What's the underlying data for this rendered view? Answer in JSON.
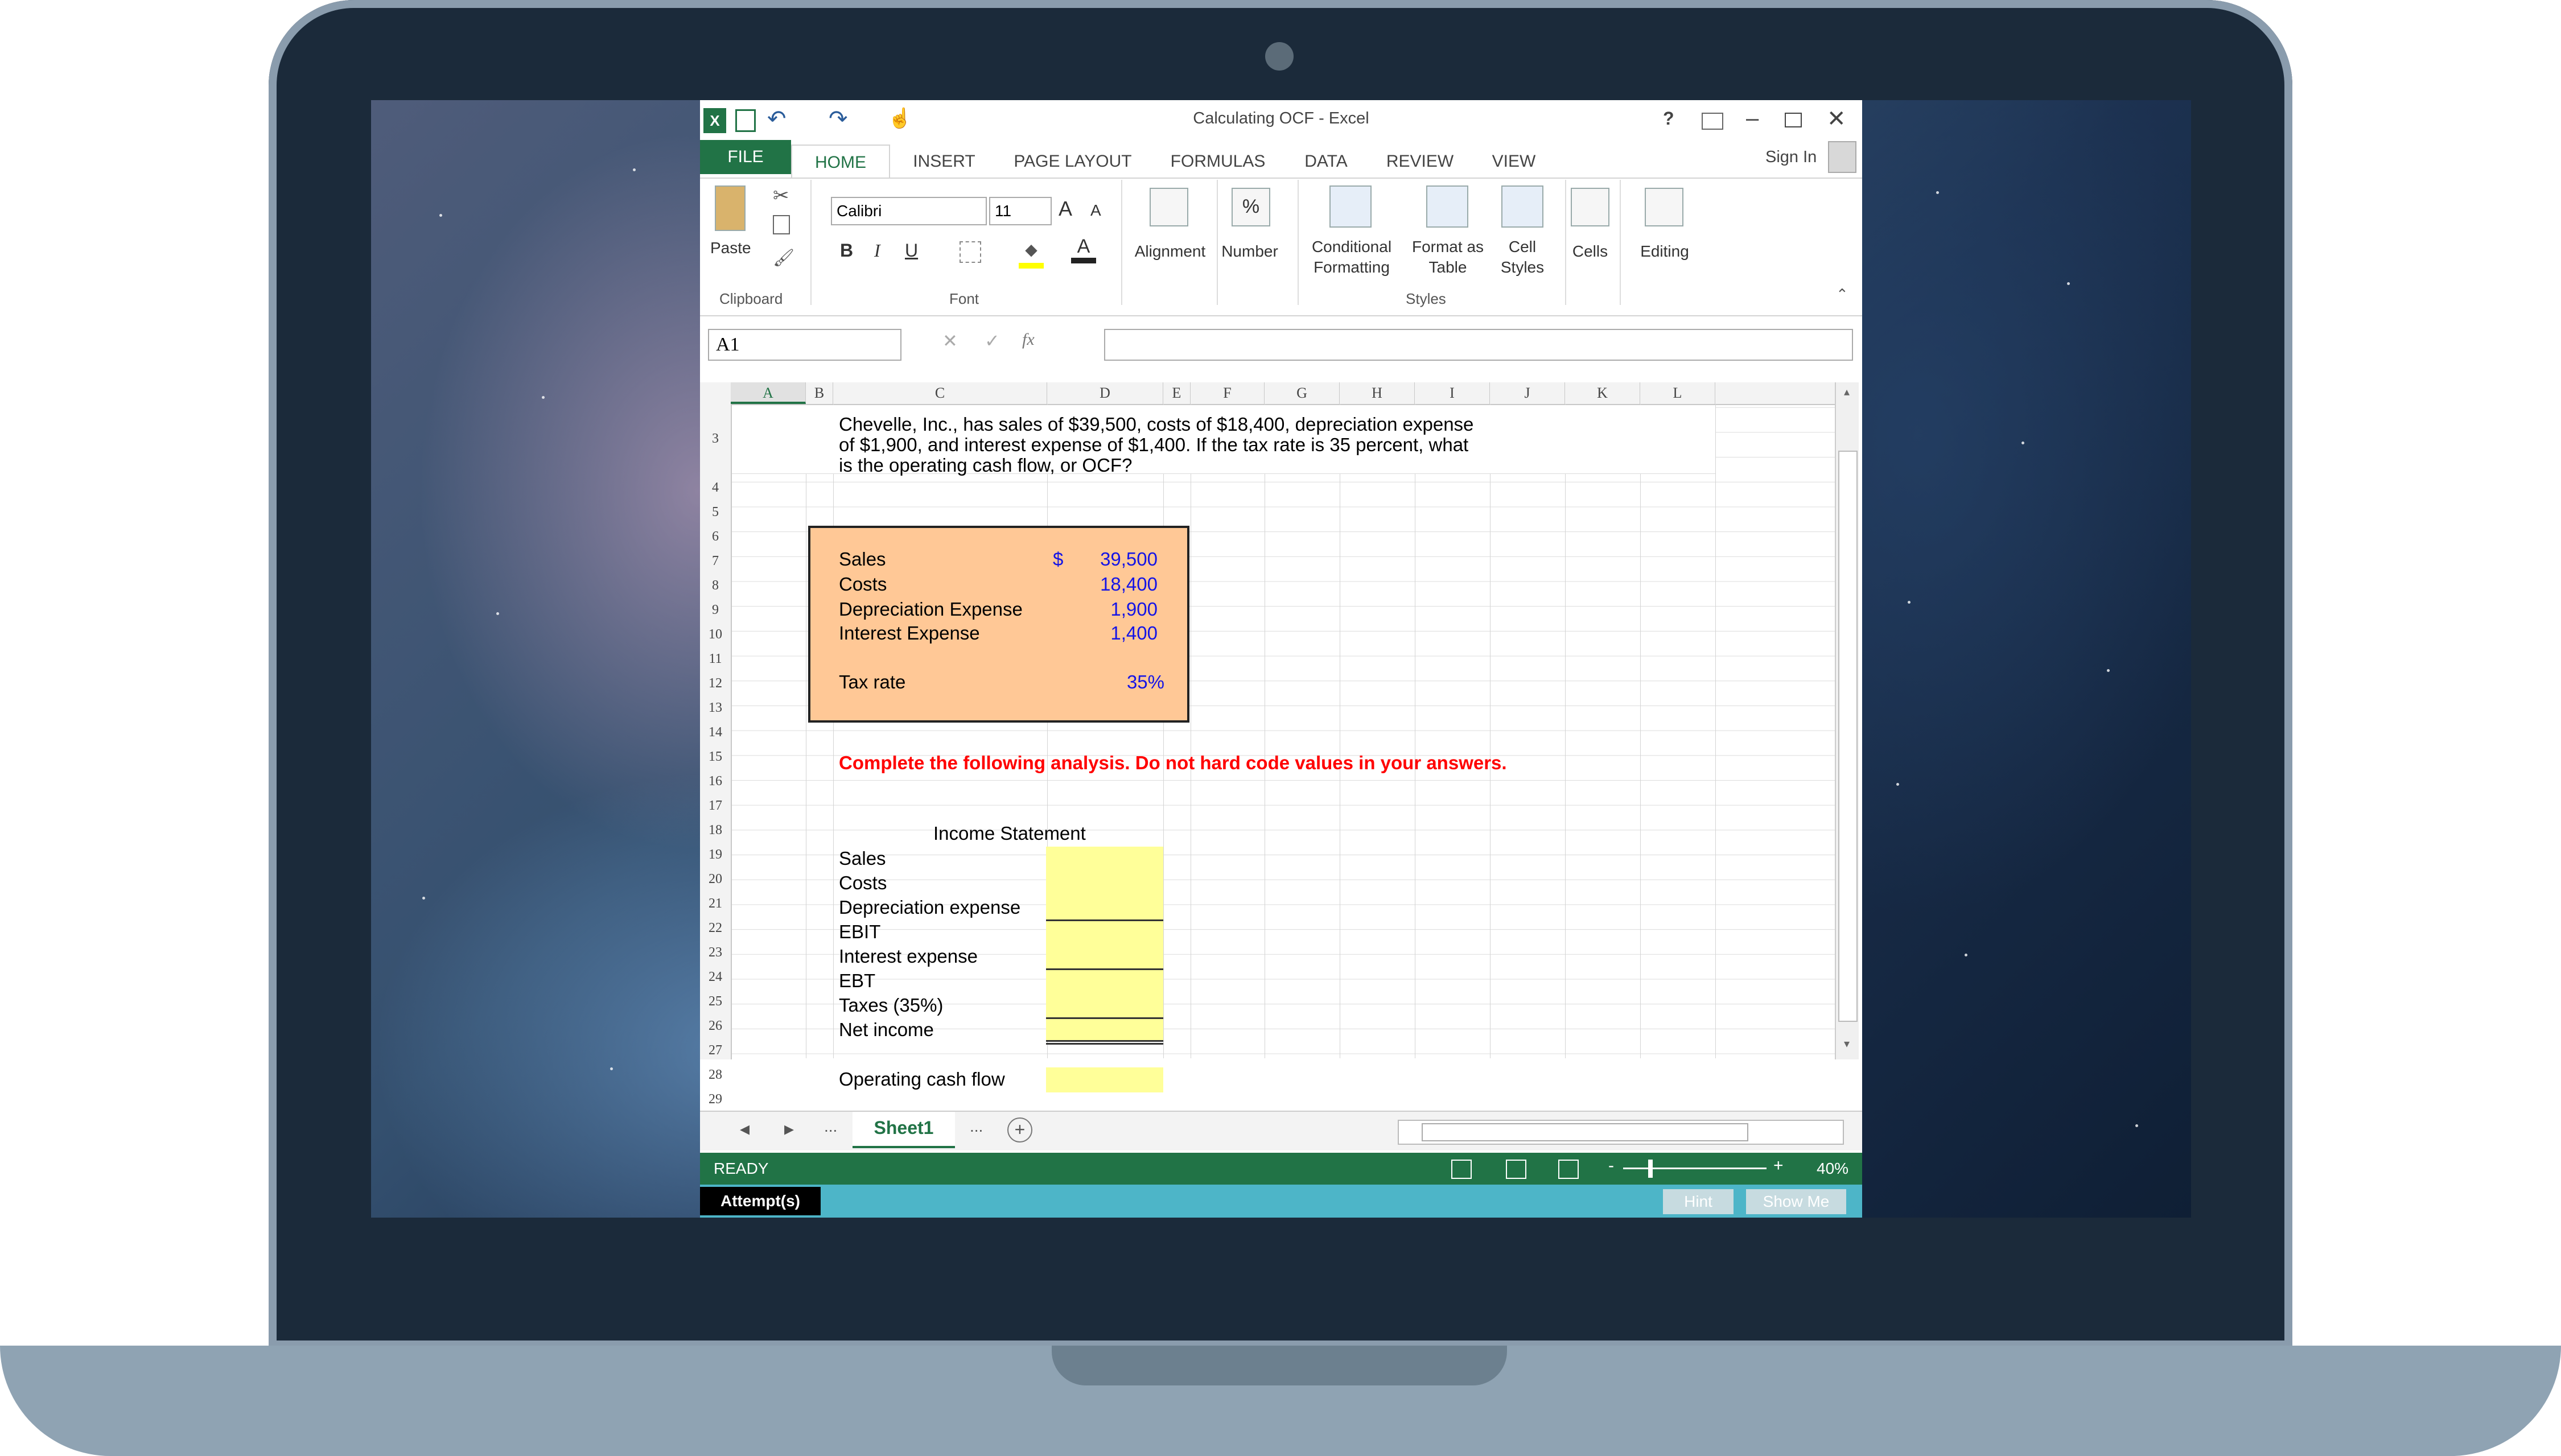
{
  "window": {
    "title": "Calculating OCF - Excel",
    "help": "?",
    "sign_in": "Sign In"
  },
  "ribbon": {
    "tabs": [
      "FILE",
      "HOME",
      "INSERT",
      "PAGE LAYOUT",
      "FORMULAS",
      "DATA",
      "REVIEW",
      "VIEW"
    ],
    "active_tab": "HOME",
    "clipboard": {
      "paste": "Paste",
      "label": "Clipboard"
    },
    "font": {
      "name": "Calibri",
      "size": "11",
      "label": "Font",
      "bold": "B",
      "italic": "I",
      "underline": "U",
      "grow": "A",
      "shrink": "A",
      "color_letter": "A"
    },
    "alignment": "Alignment",
    "number": {
      "label": "Number",
      "symbol": "%"
    },
    "styles": {
      "conditional_1": "Conditional",
      "conditional_2": "Formatting",
      "format_table_1": "Format as",
      "format_table_2": "Table",
      "cell_styles_1": "Cell",
      "cell_styles_2": "Styles",
      "label": "Styles"
    },
    "cells": "Cells",
    "editing": "Editing"
  },
  "formula_bar": {
    "name_box": "A1",
    "fx": "fx",
    "value": ""
  },
  "columns": [
    "A",
    "B",
    "C",
    "D",
    "E",
    "F",
    "G",
    "H",
    "I",
    "J",
    "K",
    "L"
  ],
  "rows": [
    "3",
    "4",
    "5",
    "6",
    "7",
    "8",
    "9",
    "10",
    "11",
    "12",
    "13",
    "14",
    "15",
    "16",
    "17",
    "18",
    "19",
    "20",
    "21",
    "22",
    "23",
    "24",
    "25",
    "26",
    "27",
    "28",
    "29"
  ],
  "sheet": {
    "problem_line1": "Chevelle, Inc., has sales of $39,500, costs of $18,400, depreciation expense",
    "problem_line2": "of $1,900, and interest expense of $1,400. If the tax rate is 35 percent, what",
    "problem_line3": "is the operating cash flow, or OCF?",
    "inputs": {
      "sales_label": "Sales",
      "sales_currency": "$",
      "sales_value": "39,500",
      "costs_label": "Costs",
      "costs_value": "18,400",
      "depr_label": "Depreciation Expense",
      "depr_value": "1,900",
      "interest_label": "Interest Expense",
      "interest_value": "1,400",
      "tax_label": "Tax rate",
      "tax_value": "35%"
    },
    "instruction": "Complete the following analysis. Do not hard code values in your answers.",
    "income_statement": {
      "title": "Income Statement",
      "items": [
        "Sales",
        "Costs",
        "Depreciation expense",
        "EBIT",
        "Interest expense",
        "EBT",
        "Taxes (35%)",
        "Net income"
      ],
      "ocf_label": "Operating cash flow"
    }
  },
  "sheet_tabs": {
    "prev": "◂",
    "next": "▸",
    "more_left": "...",
    "active": "Sheet1",
    "more_right": "...",
    "add": "+"
  },
  "status_bar": {
    "ready": "READY",
    "zoom": "40%",
    "zoom_minus": "-",
    "zoom_plus": "+"
  },
  "footer": {
    "attempts": "Attempt(s)",
    "hint": "Hint",
    "show_me": "Show Me"
  },
  "colors": {
    "excel_green": "#217346",
    "input_box": "#ffc896",
    "answer_yellow": "#ffff99",
    "footer_bar": "#4db5c8"
  }
}
